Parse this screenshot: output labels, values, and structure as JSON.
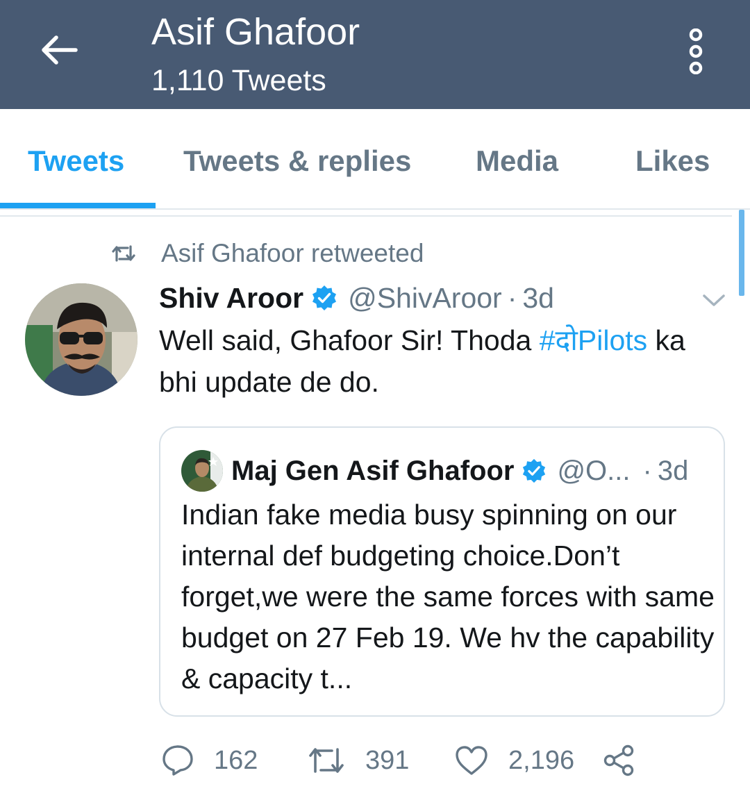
{
  "header": {
    "title": "Asif Ghafoor",
    "subtitle": "1,110 Tweets",
    "bg_color": "#485a73",
    "back_icon": "arrow-left-icon",
    "more_icon": "more-vertical-icon"
  },
  "tabs": [
    {
      "label": "Tweets",
      "active": true
    },
    {
      "label": "Tweets & replies",
      "active": false
    },
    {
      "label": "Media",
      "active": false
    },
    {
      "label": "Likes",
      "active": false
    }
  ],
  "accent_color": "#1da1f2",
  "tweet": {
    "retweet_label": "Asif Ghafoor retweeted",
    "author_name": "Shiv Aroor",
    "author_handle": "@ShivAroor",
    "separator": "·",
    "time": "3d",
    "text_before": "Well said, Ghafoor Sir! Thoda ",
    "hashtag": "#दोPilots",
    "text_after": " ka bhi update de do.",
    "quote": {
      "author_name": "Maj Gen Asif Ghafoor",
      "author_handle": "@O...",
      "separator": "·",
      "time": "3d",
      "text": "Indian fake media busy spinning on our internal def budgeting choice.Don’t forget,we were the same forces with same budget on 27 Feb 19. We hv the capability & capacity t..."
    },
    "actions": {
      "replies": "162",
      "retweets": "391",
      "likes": "2,196"
    }
  }
}
